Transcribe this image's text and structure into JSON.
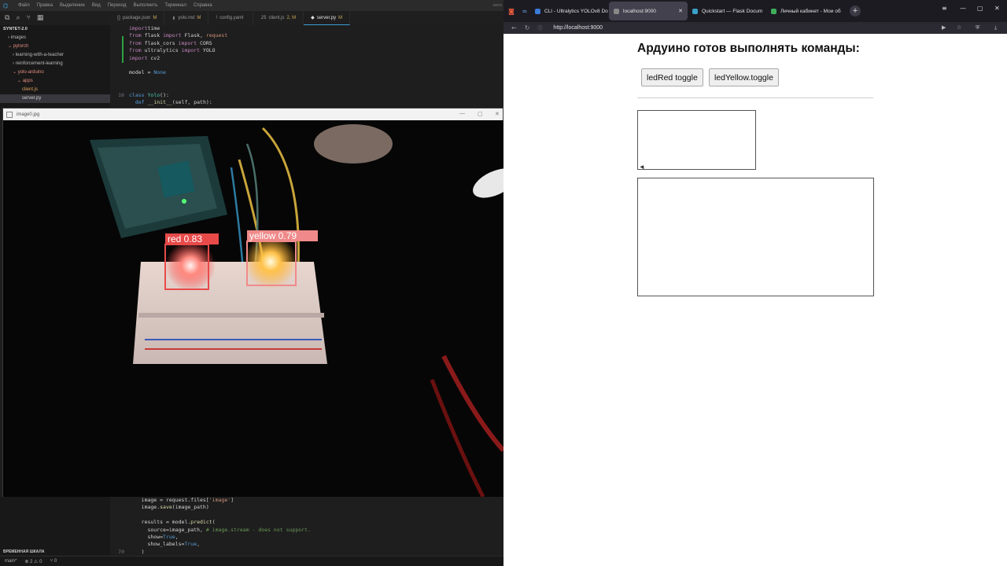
{
  "vscode": {
    "menu": [
      "Файл",
      "Правка",
      "Выделение",
      "Вид",
      "Переход",
      "Выполнить",
      "Терминал",
      "Справка"
    ],
    "menu_right": "sens",
    "tabs": [
      {
        "icon": "{}",
        "label": "package.json",
        "mod": "M"
      },
      {
        "icon": "⬇",
        "label": "yolo.md",
        "mod": "M"
      },
      {
        "icon": "!",
        "label": "config.yaml",
        "mod": ""
      },
      {
        "icon": "JS",
        "label": "client.js",
        "mod": "2, M"
      },
      {
        "icon": "◆",
        "label": "server.py",
        "mod": "M"
      }
    ],
    "explorer": {
      "root": "SYNTET-2.0",
      "items": [
        {
          "label": "› images",
          "indent": 1,
          "type": "folder"
        },
        {
          "label": "⌄ pytorch",
          "indent": 1,
          "type": "folder-open"
        },
        {
          "label": "› learning-with-a-teacher",
          "indent": 2,
          "type": "folder"
        },
        {
          "label": "› reinforcement-learning",
          "indent": 2,
          "type": "folder"
        },
        {
          "label": "⌄ yolo-arduino",
          "indent": 2,
          "type": "folder-open"
        },
        {
          "label": "⌄ apps",
          "indent": 3,
          "type": "folder-open"
        },
        {
          "label": "client.js",
          "indent": 4,
          "type": "file-js"
        },
        {
          "label": "server.py",
          "indent": 4,
          "type": "file-py"
        }
      ]
    },
    "code_top": {
      "line_number": "16",
      "lines": [
        [
          [
            "kw",
            "import"
          ],
          [
            "",
            "time"
          ]
        ],
        [
          [
            "kw",
            "from"
          ],
          [
            "",
            " flask "
          ],
          [
            "kw",
            "import"
          ],
          [
            "",
            " Flask, "
          ],
          [
            "st",
            "request"
          ]
        ],
        [
          [
            "kw",
            "from"
          ],
          [
            "",
            " flask_cors "
          ],
          [
            "kw",
            "import"
          ],
          [
            "",
            " CORS"
          ]
        ],
        [
          [
            "kw",
            "from"
          ],
          [
            "",
            " ultralytics "
          ],
          [
            "kw",
            "import"
          ],
          [
            "",
            " YOLO"
          ]
        ],
        [
          [
            "kw",
            "import"
          ],
          [
            "",
            " cv2"
          ]
        ],
        [
          [
            "",
            ""
          ]
        ],
        [
          [
            "",
            "model = "
          ],
          [
            "kw2",
            "None"
          ]
        ],
        [
          [
            "",
            ""
          ]
        ],
        [
          [
            "",
            ""
          ]
        ],
        [
          [
            "kw2",
            "class"
          ],
          [
            "",
            " "
          ],
          [
            "cls",
            "Yolo"
          ],
          [
            "",
            "():"
          ]
        ],
        [
          [
            "",
            "  "
          ],
          [
            "kw2",
            "def"
          ],
          [
            "",
            " "
          ],
          [
            "fn",
            "__init__"
          ],
          [
            "",
            "(self, path):"
          ]
        ]
      ]
    },
    "code_bottom": {
      "line_number": "70",
      "lines": [
        [
          [
            "",
            "    image = request.files["
          ],
          [
            "st",
            "'image'"
          ],
          [
            "",
            "]"
          ]
        ],
        [
          [
            "",
            "    image."
          ],
          [
            "fn",
            "save"
          ],
          [
            "",
            "(image_path)"
          ]
        ],
        [
          [
            "",
            ""
          ]
        ],
        [
          [
            "",
            "    results = model."
          ],
          [
            "fn",
            "predict"
          ],
          [
            "",
            "("
          ]
        ],
        [
          [
            "",
            "      source=image_path, "
          ],
          [
            "cm",
            "# image.stream - does not support."
          ]
        ],
        [
          [
            "",
            "      show="
          ],
          [
            "kw2",
            "True"
          ],
          [
            "",
            ","
          ]
        ],
        [
          [
            "",
            "      show_labels="
          ],
          [
            "kw2",
            "True"
          ],
          [
            "",
            ","
          ]
        ],
        [
          [
            "",
            "    )"
          ]
        ]
      ]
    },
    "timeline_label": "ВРЕМЕННАЯ ШКАЛА",
    "status": {
      "branch": "main*",
      "problems": "⊗ 2 ⚠ 0",
      "ports": "⑂ 0"
    }
  },
  "image_window": {
    "title": "image0.jpg",
    "detections": [
      {
        "label": "red",
        "confidence": "0.83",
        "color": "#e84a4a"
      },
      {
        "label": "yellow",
        "confidence": "0.79",
        "color": "#f08a8a"
      }
    ]
  },
  "browser": {
    "tabs": [
      {
        "label": "CLI - Ultralytics YOLOv8 Do",
        "icon_color": "#3b7bd8"
      },
      {
        "label": "localhost:9000",
        "icon_color": "#888888",
        "active": true
      },
      {
        "label": "Quickstart — Flask Docum",
        "icon_color": "#3aa0c8"
      },
      {
        "label": "Личный кабинет - Мои об",
        "icon_color": "#3fae5a"
      }
    ],
    "url": "http://localhost:9000"
  },
  "page": {
    "heading": "Ардуино готов выполнять команды:",
    "buttons": [
      {
        "label": "ledRed toggle"
      },
      {
        "label": "ledYellow.toggle"
      }
    ]
  }
}
